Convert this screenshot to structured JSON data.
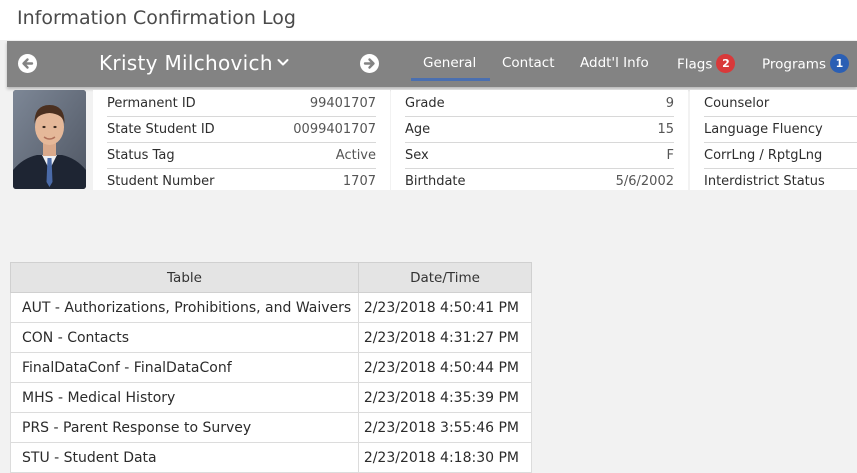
{
  "page": {
    "title": "Information Confirmation Log"
  },
  "student": {
    "name": "Kristy Milchovich",
    "tabs": [
      {
        "label": "General",
        "active": true
      },
      {
        "label": "Contact"
      },
      {
        "label": "Addt'l Info"
      },
      {
        "label": "Flags",
        "badge": "2",
        "badge_color": "#d9393a"
      },
      {
        "label": "Programs",
        "badge": "1",
        "badge_color": "#2b5fb4"
      }
    ],
    "panel1": [
      {
        "label": "Permanent ID",
        "value": "99401707"
      },
      {
        "label": "State Student ID",
        "value": "0099401707"
      },
      {
        "label": "Status Tag",
        "value": "Active"
      },
      {
        "label": "Student Number",
        "value": "1707"
      }
    ],
    "panel2": [
      {
        "label": "Grade",
        "value": "9"
      },
      {
        "label": "Age",
        "value": "15"
      },
      {
        "label": "Sex",
        "value": "F"
      },
      {
        "label": "Birthdate",
        "value": "5/6/2002"
      }
    ],
    "panel3": [
      {
        "label": "Counselor",
        "value": ""
      },
      {
        "label": "Language Fluency",
        "value": ""
      },
      {
        "label": "CorrLng / RptgLng",
        "value": ""
      },
      {
        "label": "Interdistrict Status",
        "value": ""
      }
    ]
  },
  "log": {
    "headers": {
      "table": "Table",
      "datetime": "Date/Time"
    },
    "rows": [
      {
        "table": "AUT - Authorizations, Prohibitions, and Waivers",
        "datetime": "2/23/2018 4:50:41 PM"
      },
      {
        "table": "CON - Contacts",
        "datetime": "2/23/2018 4:31:27 PM"
      },
      {
        "table": "FinalDataConf - FinalDataConf",
        "datetime": "2/23/2018 4:50:44 PM"
      },
      {
        "table": "MHS - Medical History",
        "datetime": "2/23/2018 4:35:39 PM"
      },
      {
        "table": "PRS - Parent Response to Survey",
        "datetime": "2/23/2018 3:55:46 PM"
      },
      {
        "table": "STU - Student Data",
        "datetime": "2/23/2018 4:18:30 PM"
      }
    ]
  },
  "colors": {
    "bar": "#838383",
    "active_tab_underline": "#4a6fb0",
    "flags_badge": "#d9393a",
    "programs_badge": "#2b5fb4"
  },
  "icons": {
    "prev": "circle-arrow-left-icon",
    "next": "circle-arrow-right-icon",
    "name_dropdown": "chevron-down-icon"
  }
}
